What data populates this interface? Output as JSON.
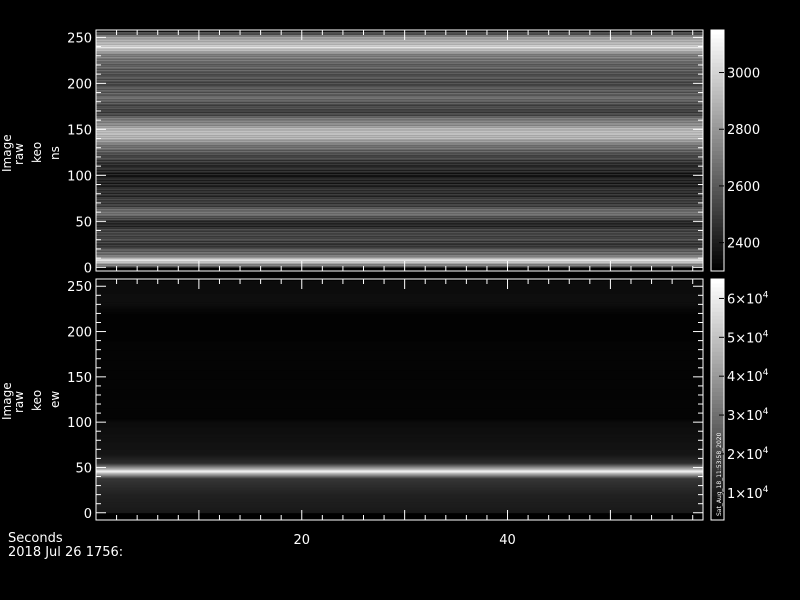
{
  "chart_data": [
    {
      "type": "heatmap",
      "ylabel": [
        "Image",
        "raw",
        "keo",
        "ns"
      ],
      "x": [
        0,
        59
      ],
      "xticks": [
        20,
        40
      ],
      "xticklabels": [
        "20",
        "40"
      ],
      "ylim": [
        -4,
        258
      ],
      "yticks": [
        0,
        50,
        100,
        150,
        200,
        250
      ],
      "yticklabels": [
        "0",
        "50",
        "100",
        "150",
        "200",
        "250"
      ],
      "colorbar": {
        "range": [
          2300,
          3150
        ],
        "ticks": [
          2400,
          2600,
          2800,
          3000
        ],
        "ticklabels": [
          "2400",
          "2600",
          "2800",
          "3000"
        ]
      },
      "row_intensity": [
        {
          "y": 0,
          "value": 2550
        },
        {
          "y": 8,
          "value": 3050
        },
        {
          "y": 13,
          "value": 2700
        },
        {
          "y": 25,
          "value": 2480
        },
        {
          "y": 35,
          "value": 2550
        },
        {
          "y": 50,
          "value": 2420
        },
        {
          "y": 58,
          "value": 2700
        },
        {
          "y": 70,
          "value": 2500
        },
        {
          "y": 85,
          "value": 2450
        },
        {
          "y": 100,
          "value": 2400
        },
        {
          "y": 115,
          "value": 2480
        },
        {
          "y": 130,
          "value": 2650
        },
        {
          "y": 145,
          "value": 2950
        },
        {
          "y": 155,
          "value": 2800
        },
        {
          "y": 170,
          "value": 2500
        },
        {
          "y": 185,
          "value": 2650
        },
        {
          "y": 200,
          "value": 2550
        },
        {
          "y": 215,
          "value": 2600
        },
        {
          "y": 230,
          "value": 2700
        },
        {
          "y": 240,
          "value": 3000
        },
        {
          "y": 250,
          "value": 2800
        },
        {
          "y": 256,
          "value": 2500
        }
      ]
    },
    {
      "type": "heatmap",
      "ylabel": [
        "Image",
        "raw",
        "keo",
        "ew"
      ],
      "x": [
        0,
        59
      ],
      "xticks": [
        20,
        40
      ],
      "xticklabels": [
        "20",
        "40"
      ],
      "ylim": [
        -8,
        258
      ],
      "yticks": [
        0,
        50,
        100,
        150,
        200,
        250
      ],
      "yticklabels": [
        "0",
        "50",
        "100",
        "150",
        "200",
        "250"
      ],
      "colorbar": {
        "range": [
          3000,
          65000
        ],
        "ticks": [
          10000,
          20000,
          30000,
          40000,
          50000,
          60000
        ],
        "ticklabels": [
          {
            "mant": "1",
            "exp": "4"
          },
          {
            "mant": "2",
            "exp": "4"
          },
          {
            "mant": "3",
            "exp": "4"
          },
          {
            "mant": "4",
            "exp": "4"
          },
          {
            "mant": "5",
            "exp": "4"
          },
          {
            "mant": "6",
            "exp": "4"
          }
        ],
        "annotation": "Sat_Aug_18_11:53:58_2020"
      },
      "row_intensity": [
        {
          "y": 0,
          "value": 9000
        },
        {
          "y": 20,
          "value": 11000
        },
        {
          "y": 38,
          "value": 16000
        },
        {
          "y": 44,
          "value": 48000
        },
        {
          "y": 46,
          "value": 65000
        },
        {
          "y": 48,
          "value": 48000
        },
        {
          "y": 55,
          "value": 14000
        },
        {
          "y": 65,
          "value": 8000
        },
        {
          "y": 100,
          "value": 6000
        },
        {
          "y": 104,
          "value": 4000
        },
        {
          "y": 220,
          "value": 3800
        },
        {
          "y": 232,
          "value": 6500
        },
        {
          "y": 256,
          "value": 6000
        }
      ]
    }
  ],
  "footer": {
    "x_axis_title": "Seconds",
    "date_line": "2018 Jul 26 1756:"
  }
}
